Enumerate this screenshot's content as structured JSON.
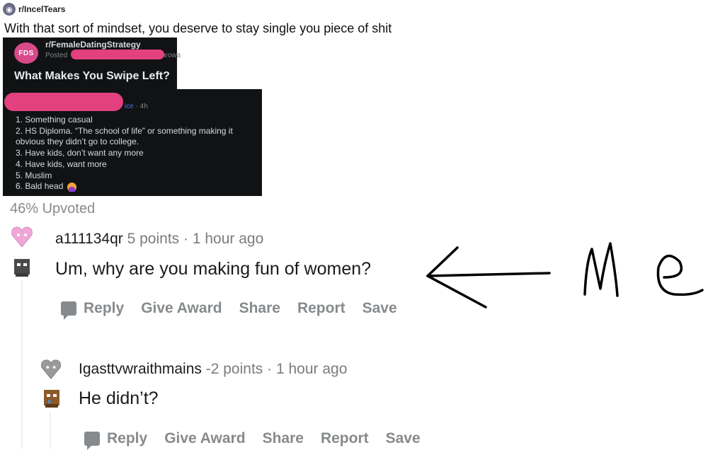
{
  "subreddit": {
    "name": "r/IncelTears",
    "avatar_icon": "owl-avatar-icon"
  },
  "post": {
    "title": "With that sort of mindset, you deserve to stay single you piece of shit",
    "upvote_ratio": "46% Upvoted"
  },
  "embedded_screenshot": {
    "logo_text": "FDS",
    "subreddit": "r/FemaleDatingStrategy",
    "posted_prefix": "Posted",
    "posted_suffix": "hrowa",
    "title": "What Makes You Swipe Left?",
    "comment_flair": "ice",
    "comment_time": " · 4h",
    "list": [
      "1. Something casual",
      "2. HS Diploma. “The school of life” or something making it",
      "obvious they didn’t go to college.",
      "3. Have kids, don’t want any more",
      "4. Have kids, want more",
      "5. Muslim",
      "6. Bald head"
    ]
  },
  "comments": [
    {
      "username": "a111134qr",
      "points": "5 points",
      "separator": "·",
      "time": "1 hour ago",
      "body": "Um, why are you making fun of women?",
      "actions": [
        "Reply",
        "Give Award",
        "Share",
        "Report",
        "Save"
      ]
    },
    {
      "username": "Igasttvwraithmains",
      "points": "-2 points",
      "separator": "·",
      "time": "1 hour ago",
      "body": "He didn’t?",
      "actions": [
        "Reply",
        "Give Award",
        "Share",
        "Report",
        "Save"
      ]
    }
  ],
  "annotation": {
    "text": "Me"
  },
  "colors": {
    "redaction": "#e2407f",
    "embed_bg": "#111214",
    "heart_pink": "#f0a6d6",
    "heart_grey": "#9a9a9a"
  }
}
